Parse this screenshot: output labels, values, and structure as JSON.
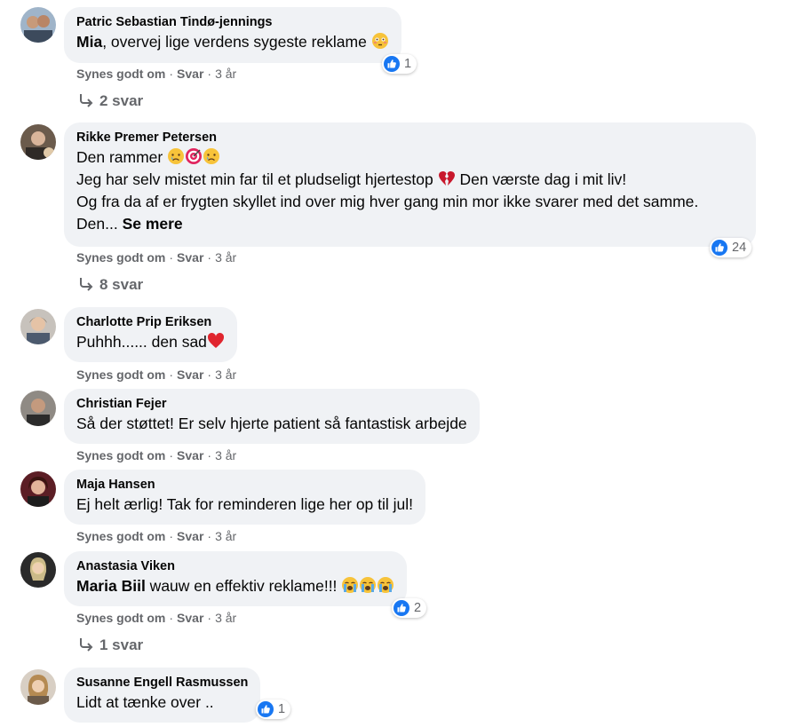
{
  "colors": {
    "bubble": "#f0f2f5",
    "meta": "#65676b",
    "like_blue": "#1877f2"
  },
  "comments": [
    {
      "author": "Patric Sebastian Tindø-jennings",
      "mention": "Mia",
      "text": ", overvej lige verdens sygeste reklame",
      "emoji": "flushed-face",
      "reactions": "1",
      "like": "Synes godt om",
      "reply": "Svar",
      "time": "3 år",
      "replies": "2 svar"
    },
    {
      "author": "Rikke Premer Petersen",
      "line1": "Den rammer",
      "line1_emojis": [
        "crying-face",
        "target",
        "crying-face"
      ],
      "line2": "Jeg har selv mistet min far til et pludseligt hjertestop",
      "line2_emoji": "broken-heart",
      "line2_tail": " Den værste dag i mit liv!",
      "line3": "Og fra da af er frygten skyllet ind over mig hver gang min mor ikke svarer med det samme.",
      "line4": "Den... ",
      "see_more": "Se mere",
      "reactions": "24",
      "like": "Synes godt om",
      "reply": "Svar",
      "time": "3 år",
      "replies": "8 svar"
    },
    {
      "author": "Charlotte Prip Eriksen",
      "text": "Puhhh...... den sad",
      "emoji": "red-heart",
      "like": "Synes godt om",
      "reply": "Svar",
      "time": "3 år"
    },
    {
      "author": "Christian Fejer",
      "text": "Så der støttet! Er selv hjerte patient så fantastisk arbejde",
      "like": "Synes godt om",
      "reply": "Svar",
      "time": "3 år"
    },
    {
      "author": "Maja Hansen",
      "text": "Ej helt ærlig! Tak for reminderen lige her op til jul!",
      "like": "Synes godt om",
      "reply": "Svar",
      "time": "3 år"
    },
    {
      "author": "Anastasia Viken",
      "mention": "Maria Biil",
      "text": " wauw en effektiv reklame!!!",
      "emojis": [
        "loudly-crying-face",
        "loudly-crying-face",
        "loudly-crying-face"
      ],
      "reactions": "2",
      "like": "Synes godt om",
      "reply": "Svar",
      "time": "3 år",
      "replies": "1 svar"
    },
    {
      "author": "Susanne Engell Rasmussen",
      "text": "Lidt at tænke over ..",
      "reactions": "1"
    }
  ]
}
